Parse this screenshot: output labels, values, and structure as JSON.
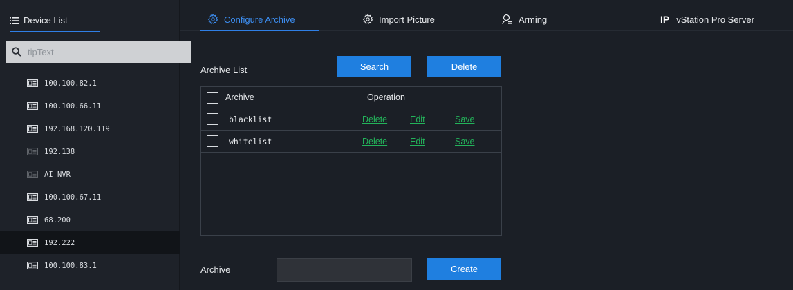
{
  "sidebar": {
    "title": "Device List",
    "search": {
      "placeholder": "tipText",
      "value": ""
    },
    "devices": [
      {
        "label": "100.100.82.1",
        "status": "online"
      },
      {
        "label": "100.100.66.11",
        "status": "online"
      },
      {
        "label": "192.168.120.119",
        "status": "online"
      },
      {
        "label": "192.138",
        "status": "offline"
      },
      {
        "label": "AI NVR",
        "status": "offline"
      },
      {
        "label": "100.100.67.11",
        "status": "online"
      },
      {
        "label": "68.200",
        "status": "online"
      },
      {
        "label": "192.222",
        "status": "online",
        "selected": true
      },
      {
        "label": "100.100.83.1",
        "status": "online"
      }
    ]
  },
  "tabs": [
    {
      "label": "Configure Archive",
      "icon": "settings-icon",
      "active": true
    },
    {
      "label": "Import Picture",
      "icon": "settings-icon"
    },
    {
      "label": "Arming",
      "icon": "person-list-icon"
    },
    {
      "label": "vStation Pro Server",
      "icon_text": "IP"
    }
  ],
  "archive_list": {
    "label": "Archive List",
    "search_button": "Search",
    "delete_button": "Delete",
    "columns": [
      "Archive",
      "Operation"
    ],
    "rows": [
      {
        "name": "blacklist",
        "ops": [
          "Delete",
          "Edit",
          "Save"
        ]
      },
      {
        "name": "whitelist",
        "ops": [
          "Delete",
          "Edit",
          "Save"
        ]
      }
    ]
  },
  "create_form": {
    "label": "Archive",
    "value": "",
    "create_button": "Create"
  },
  "colors": {
    "accent": "#2f7fe6",
    "link": "#23b35a",
    "background": "#1b1f26"
  }
}
